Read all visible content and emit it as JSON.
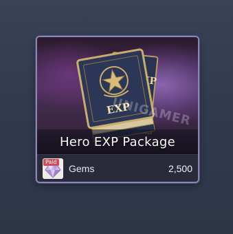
{
  "package": {
    "title": "Hero EXP Package",
    "art_icon": "exp-book-stack",
    "watermark": "UNIGAMER"
  },
  "price": {
    "paid_badge": "Paid",
    "currency_icon": "gem-icon",
    "currency_label": "Gems",
    "amount": "2,500"
  },
  "book": {
    "cover_text": "EXP",
    "back_cover_text": "EXP"
  },
  "colors": {
    "card_border": "#8a86b4",
    "paid_badge": "#d24a5a",
    "background": "#343c50"
  }
}
